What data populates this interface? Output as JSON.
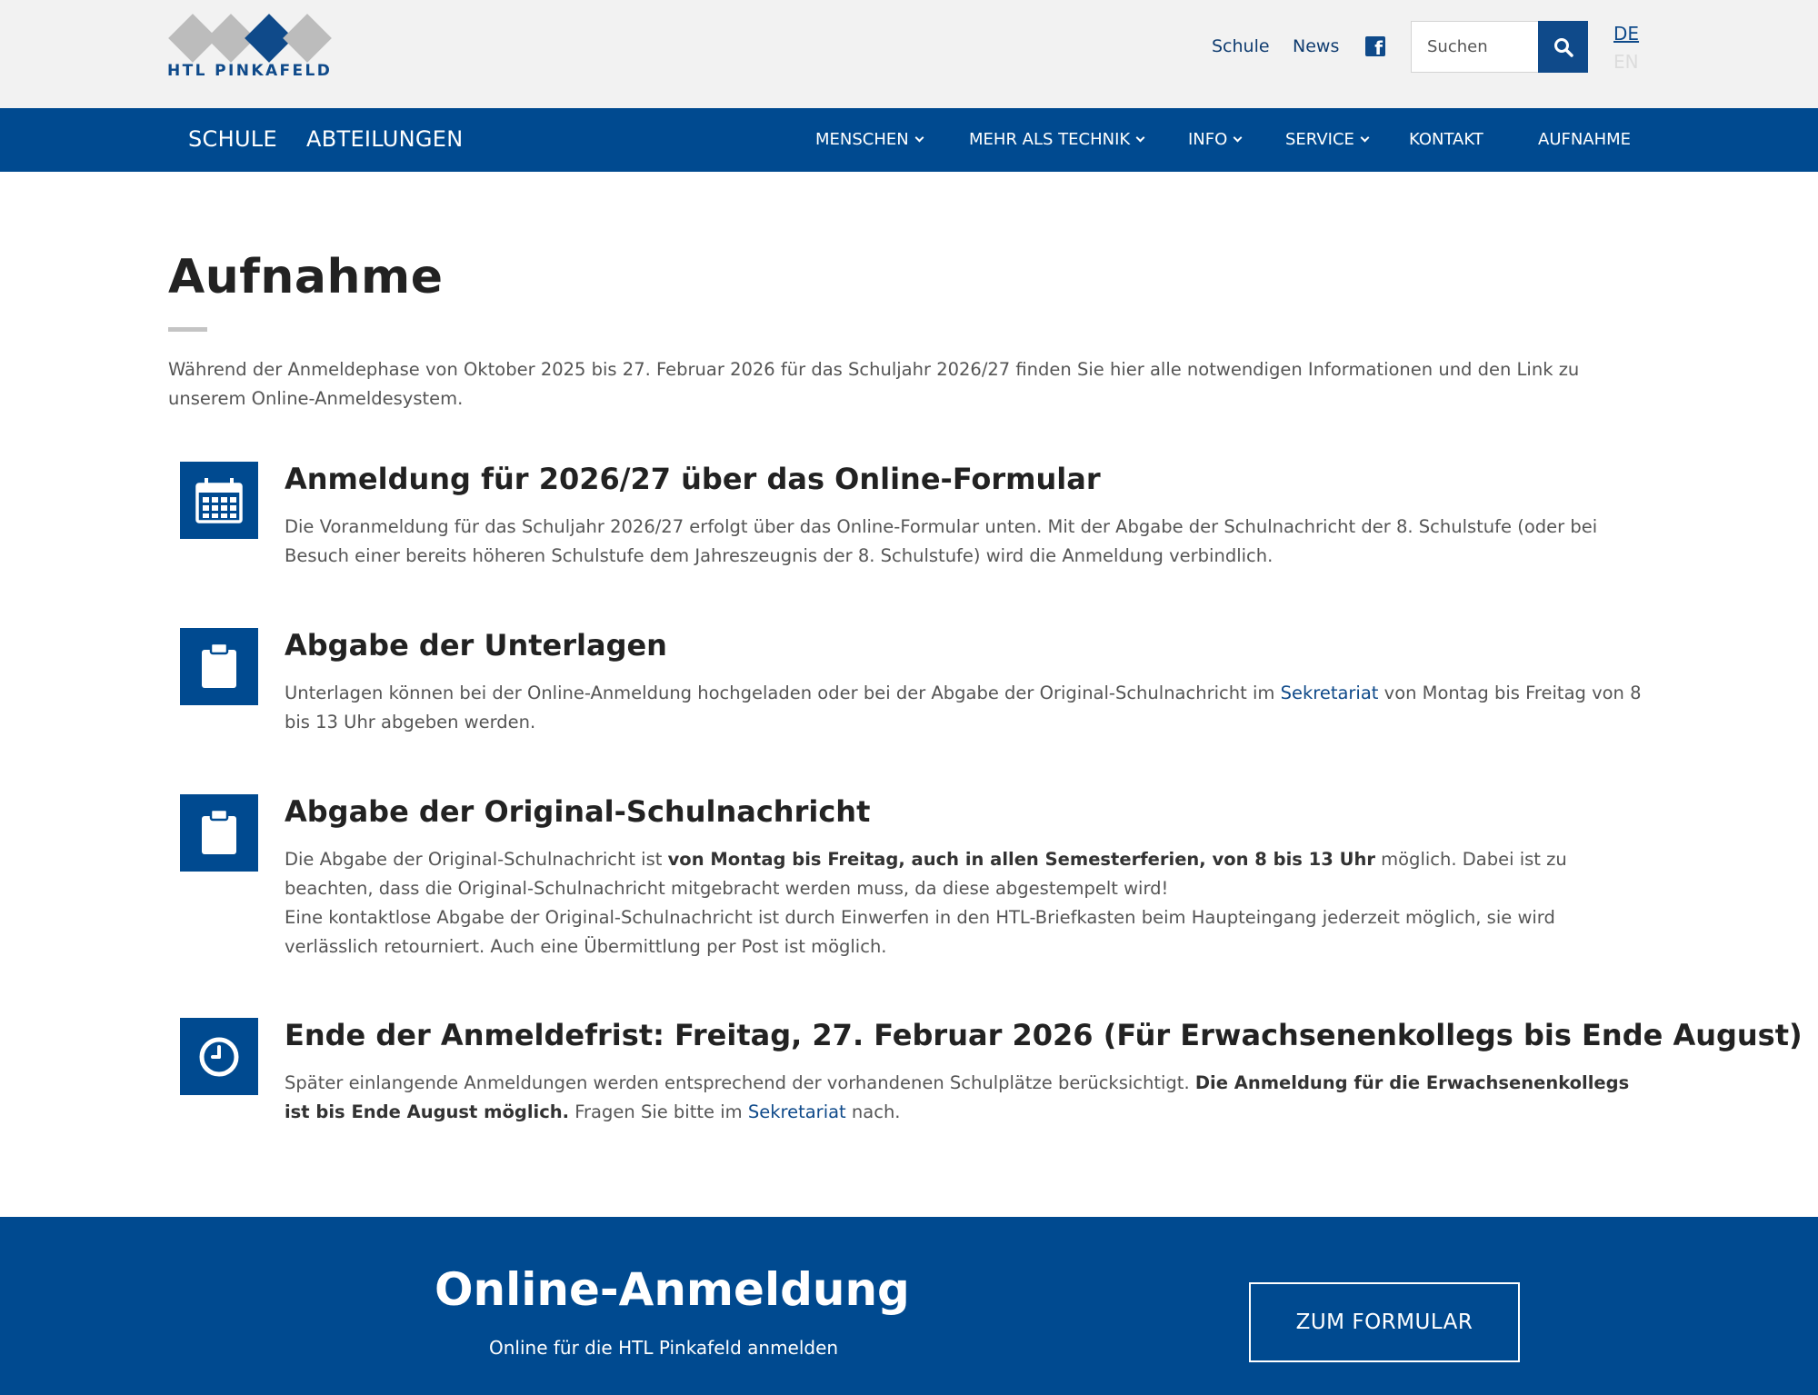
{
  "brand": {
    "logo_text": "HTL PINKAFELD"
  },
  "header": {
    "links": [
      {
        "label": "Schule"
      },
      {
        "label": "News"
      }
    ],
    "facebook_icon": "facebook-icon",
    "search": {
      "placeholder": "Suchen",
      "icon": "search-icon"
    },
    "languages": {
      "de": "DE",
      "en": "EN"
    }
  },
  "nav": {
    "primary": [
      {
        "label": "SCHULE"
      },
      {
        "label": "ABTEILUNGEN"
      }
    ],
    "items": [
      {
        "label": "MENSCHEN",
        "has_dropdown": true
      },
      {
        "label": "MEHR ALS TECHNIK",
        "has_dropdown": true
      },
      {
        "label": "INFO",
        "has_dropdown": true
      },
      {
        "label": "SERVICE",
        "has_dropdown": true
      },
      {
        "label": "KONTAKT",
        "has_dropdown": false
      },
      {
        "label": "AUFNAHME",
        "has_dropdown": false
      }
    ]
  },
  "page": {
    "title": "Aufnahme",
    "intro": "Während der Anmeldephase von Oktober 2025 bis 27. Februar 2026 für das Schuljahr 2026/27 finden Sie hier alle notwendigen Informationen und den Link zu unserem Online-Anmeldesystem."
  },
  "sections": [
    {
      "icon": "calendar-icon",
      "title": "Anmeldung für 2026/27 über das Online-Formular",
      "body": "Die Voranmeldung für das Schuljahr 2026/27 erfolgt über das Online-Formular unten. Mit der Abgabe der Schulnachricht der 8. Schulstufe (oder bei Besuch einer bereits höheren Schulstufe dem Jahreszeugnis der 8. Schulstufe) wird die Anmeldung verbindlich."
    },
    {
      "icon": "clipboard-icon",
      "title": "Abgabe der Unterlagen",
      "body_pre": "Unterlagen können bei der Online-Anmeldung hochgeladen oder bei der Abgabe der Original-Schulnachricht im ",
      "body_link": "Sekretariat",
      "body_post": " von Montag bis Freitag von 8 bis 13 Uhr abgeben werden."
    },
    {
      "icon": "clipboard-icon",
      "title": "Abgabe der Original-Schulnachricht",
      "body_pre": "Die Abgabe der Original-Schulnachricht ist ",
      "body_bold": "von Montag bis Freitag, auch in allen Semesterferien, von 8 bis 13 Uhr",
      "body_post": " möglich. Dabei ist zu beachten, dass die Original-Schulnachricht mitgebracht werden muss, da diese abgestempelt wird!",
      "body_2": "Eine kontaktlose Abgabe der Original-Schulnachricht ist durch Einwerfen in den HTL-Briefkasten beim Haupteingang jederzeit möglich, sie wird verlässlich retourniert. Auch eine Übermittlung per Post ist möglich."
    },
    {
      "icon": "clock-icon",
      "title": "Ende der Anmeldefrist: Freitag, 27. Februar 2026 (Für Erwachsenenkollegs bis Ende August)",
      "body_pre": "Später einlangende Anmeldungen werden entsprechend der vorhandenen Schulplätze berücksichtigt. ",
      "body_bold": "Die Anmeldung für die Erwachsenenkollegs ist bis Ende August möglich.",
      "body_mid": " Fragen Sie bitte im ",
      "body_link": "Sekretariat",
      "body_post": " nach."
    }
  ],
  "footer": {
    "title": "Online-Anmeldung",
    "subtitle": "Online für die HTL Pinkafeld anmelden",
    "button": "ZUM FORMULAR"
  },
  "colors": {
    "primary": "#004a90",
    "topbar": "#f2f2f2",
    "logo_gray": "#bcbcbc"
  }
}
